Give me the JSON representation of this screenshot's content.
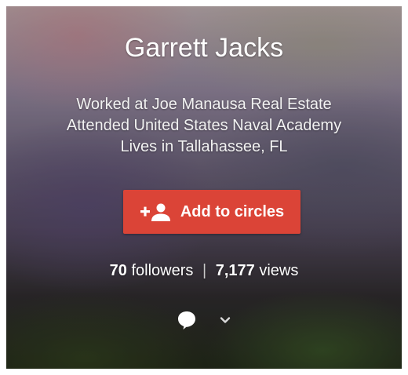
{
  "profile": {
    "name": "Garrett Jacks",
    "details": [
      "Worked at Joe Manausa Real Estate",
      "Attended United States Naval Academy",
      "Lives in Tallahassee, FL"
    ]
  },
  "actions": {
    "add_to_circles_label": "Add to circles",
    "add_to_circles_icon": "add-person-icon",
    "accent_color": "#db4437"
  },
  "stats": {
    "followers_count": "70",
    "followers_label": "followers",
    "separator": "|",
    "views_count": "7,177",
    "views_label": "views"
  },
  "footer_icons": [
    "speech-bubble-icon",
    "chevron-down-icon"
  ]
}
